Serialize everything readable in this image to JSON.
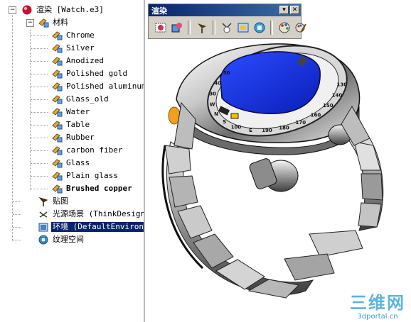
{
  "tree": {
    "root_label": "渲染 [Watch.e3]",
    "materials_label": "材料",
    "materials": [
      "Chrome",
      "Silver",
      "Anodized",
      "Polished gold",
      "Polished aluminum",
      "Glass_old",
      "Water",
      "Table",
      "Rubber",
      "carbon fiber",
      "Glass",
      "Plain glass",
      "Brushed copper"
    ],
    "decal_label": "贴图",
    "light_label": "光源场景 (ThinkDesign",
    "env_label": "环境 (DefaultEnvironm",
    "texspace_label": "纹理空间",
    "expander_minus": "−"
  },
  "toolbar": {
    "title": "渲染",
    "dropdown_glyph": "▾",
    "close_glyph": "✕"
  },
  "watch": {
    "bezel_numbers": [
      "130",
      "140",
      "150",
      "160",
      "170",
      "180",
      "190",
      "E",
      "100",
      "S",
      "N",
      "W",
      "30",
      "40",
      "50"
    ]
  },
  "watermark": {
    "brand": "三维网",
    "url": "3dportal.cn"
  },
  "colors": {
    "selection": "#0a246a",
    "screen": "#1432e6",
    "accent": "#f0a020"
  }
}
